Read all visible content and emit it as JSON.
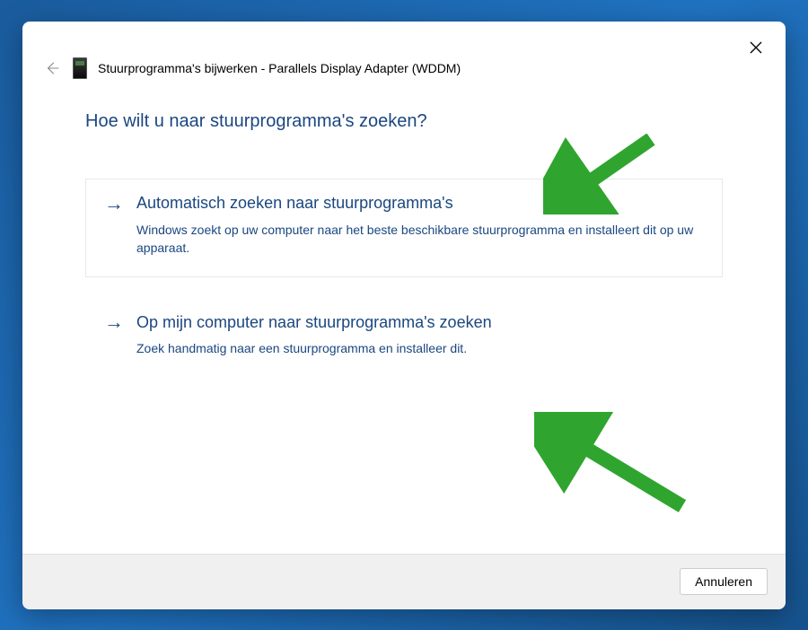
{
  "window": {
    "title": "Stuurprogramma's bijwerken - Parallels Display Adapter (WDDM)"
  },
  "main": {
    "question": "Hoe wilt u naar stuurprogramma's zoeken?",
    "options": [
      {
        "title": "Automatisch zoeken naar stuurprogramma's",
        "description": "Windows zoekt op uw computer naar het beste beschikbare stuurprogramma en installeert dit op uw apparaat."
      },
      {
        "title": "Op mijn computer naar stuurprogramma's zoeken",
        "description": "Zoek handmatig naar een stuurprogramma en installeer dit."
      }
    ]
  },
  "footer": {
    "cancel_label": "Annuleren"
  }
}
